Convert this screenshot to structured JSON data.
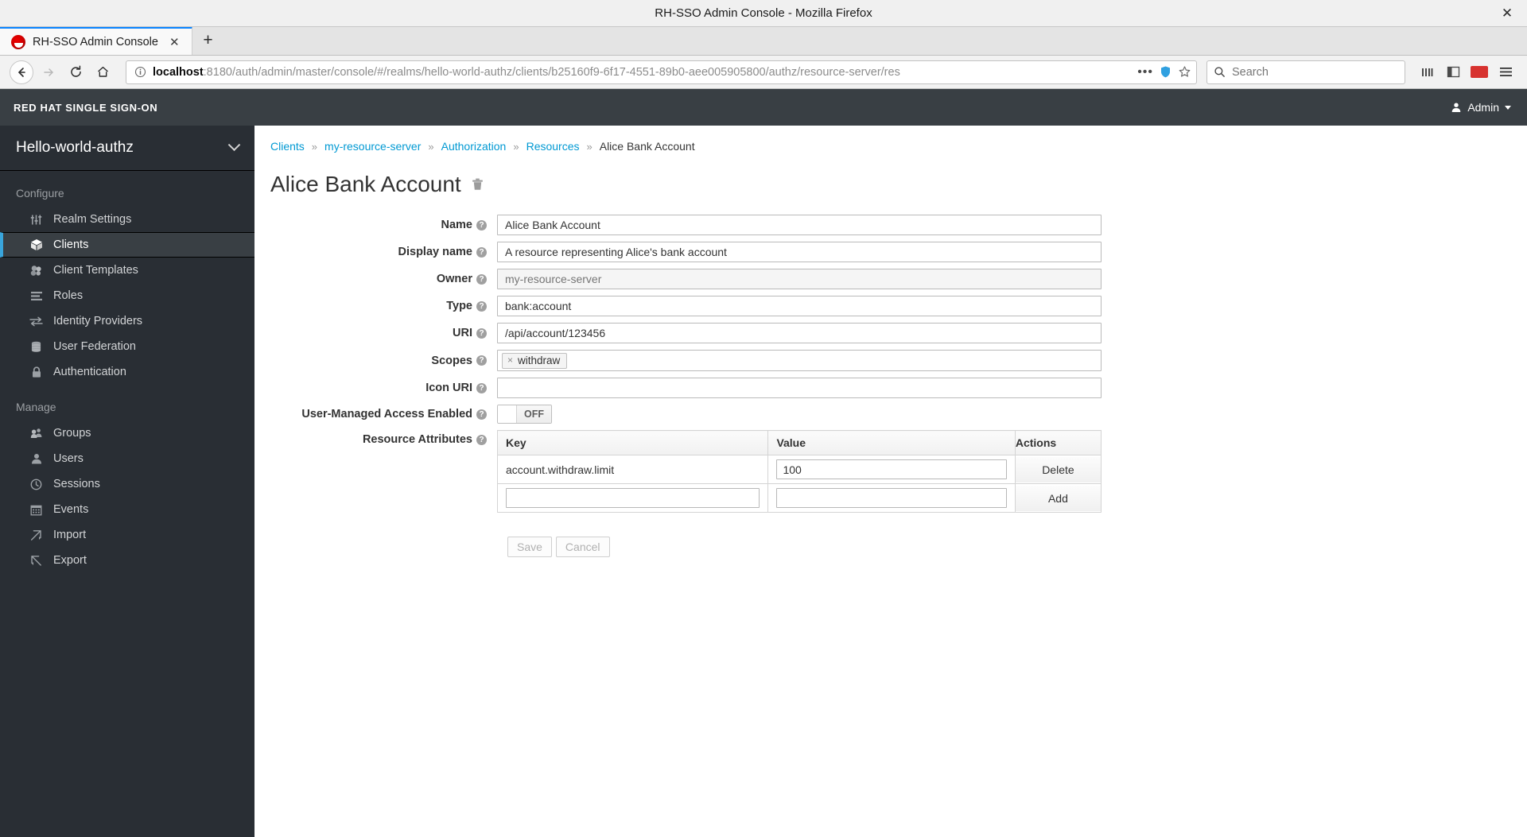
{
  "browser": {
    "window_title": "RH-SSO Admin Console - Mozilla Firefox",
    "close_glyph": "✕",
    "tab": {
      "title": "RH-SSO Admin Console",
      "close_glyph": "✕",
      "favicon_name": "red-hat-logo"
    },
    "new_tab_glyph": "+",
    "url_host": "localhost",
    "url_rest": ":8180/auth/admin/master/console/#/realms/hello-world-authz/clients/b25160f9-6f17-4551-89b0-aee005905800/authz/resource-server/res",
    "overflow_glyph": "•••",
    "search_placeholder": "Search"
  },
  "masthead": {
    "brand": "RED HAT SINGLE SIGN-ON",
    "user": "Admin"
  },
  "sidebar": {
    "realm": "Hello-world-authz",
    "sections": [
      {
        "heading": "Configure",
        "items": [
          {
            "label": "Realm Settings",
            "icon": "sliders-icon",
            "active": false
          },
          {
            "label": "Clients",
            "icon": "cube-icon",
            "active": true
          },
          {
            "label": "Client Templates",
            "icon": "blocks-icon",
            "active": false
          },
          {
            "label": "Roles",
            "icon": "list-icon",
            "active": false
          },
          {
            "label": "Identity Providers",
            "icon": "exchange-icon",
            "active": false
          },
          {
            "label": "User Federation",
            "icon": "database-icon",
            "active": false
          },
          {
            "label": "Authentication",
            "icon": "lock-icon",
            "active": false
          }
        ]
      },
      {
        "heading": "Manage",
        "items": [
          {
            "label": "Groups",
            "icon": "groups-icon",
            "active": false
          },
          {
            "label": "Users",
            "icon": "user-icon",
            "active": false
          },
          {
            "label": "Sessions",
            "icon": "clock-icon",
            "active": false
          },
          {
            "label": "Events",
            "icon": "calendar-icon",
            "active": false
          },
          {
            "label": "Import",
            "icon": "import-icon",
            "active": false
          },
          {
            "label": "Export",
            "icon": "export-icon",
            "active": false
          }
        ]
      }
    ]
  },
  "breadcrumb": {
    "separator": "»",
    "items": [
      {
        "label": "Clients",
        "link": true
      },
      {
        "label": "my-resource-server",
        "link": true
      },
      {
        "label": "Authorization",
        "link": true
      },
      {
        "label": "Resources",
        "link": true
      },
      {
        "label": "Alice Bank Account",
        "link": false
      }
    ]
  },
  "page": {
    "title": "Alice Bank Account",
    "delete_icon": "trash-icon"
  },
  "form": {
    "help_glyph": "?",
    "fields": [
      {
        "label": "Name",
        "value": "Alice Bank Account",
        "placeholder": "",
        "disabled": false
      },
      {
        "label": "Display name",
        "value": "A resource representing Alice's bank account",
        "placeholder": "",
        "disabled": false
      },
      {
        "label": "Owner",
        "value": "",
        "placeholder": "my-resource-server",
        "disabled": true
      },
      {
        "label": "Type",
        "value": "bank:account",
        "placeholder": "",
        "disabled": false
      },
      {
        "label": "URI",
        "value": "/api/account/123456",
        "placeholder": "",
        "disabled": false
      }
    ],
    "scopes": {
      "label": "Scopes",
      "chips": [
        {
          "label": "withdraw",
          "remove_glyph": "×"
        }
      ]
    },
    "icon_uri": {
      "label": "Icon URI",
      "value": "",
      "placeholder": ""
    },
    "uma": {
      "label": "User-Managed Access Enabled",
      "state": "OFF"
    },
    "attributes": {
      "label": "Resource Attributes",
      "columns": [
        "Key",
        "Value",
        "Actions"
      ],
      "rows": [
        {
          "key": "account.withdraw.limit",
          "value": "100",
          "action": "Delete",
          "key_editable": false
        }
      ],
      "new_row": {
        "key": "",
        "value": "",
        "action": "Add",
        "key_editable": true
      }
    },
    "buttons": {
      "save": "Save",
      "cancel": "Cancel"
    }
  }
}
